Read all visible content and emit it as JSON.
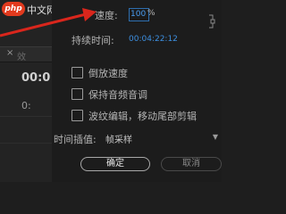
{
  "watermark": {
    "logo": "php",
    "text": "中文网"
  },
  "left_panel": {
    "close_glyph": "×",
    "tab_label": "效",
    "timecode": "00:0",
    "sub_value": "0:"
  },
  "speed": {
    "label": "速度:",
    "value": "100",
    "unit": "%"
  },
  "duration": {
    "label": "持续时间:",
    "value": "00:04:22:12"
  },
  "options": [
    {
      "label": "倒放速度",
      "checked": false
    },
    {
      "label": "保持音频音调",
      "checked": false
    },
    {
      "label": "波纹编辑，移动尾部剪辑",
      "checked": false
    }
  ],
  "interpolation": {
    "label": "时间插值:",
    "selected": "帧采样"
  },
  "buttons": {
    "ok": "确定",
    "cancel": "取消"
  },
  "colors": {
    "accent": "#3d8fe0",
    "annotation": "#d9261c",
    "background": "#1c1c1c"
  }
}
